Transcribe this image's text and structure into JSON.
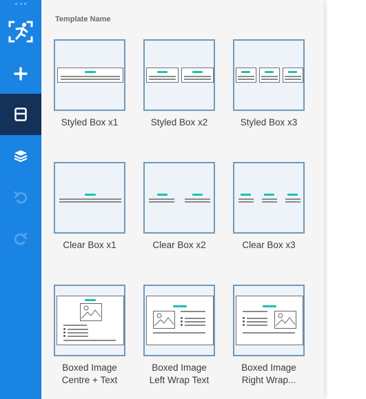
{
  "panel": {
    "title": "Template Name"
  },
  "sidebar": {
    "buttons": [
      {
        "name": "logo",
        "icon": "runner-logo-icon"
      },
      {
        "name": "add",
        "icon": "plus-icon"
      },
      {
        "name": "templates",
        "icon": "layout-icon",
        "active": true
      },
      {
        "name": "layers",
        "icon": "layers-icon"
      },
      {
        "name": "undo",
        "icon": "undo-icon",
        "disabled": true
      },
      {
        "name": "redo",
        "icon": "redo-icon",
        "disabled": true
      }
    ]
  },
  "templates": [
    {
      "label": "Styled Box x1"
    },
    {
      "label": "Styled Box x2"
    },
    {
      "label": "Styled Box x3"
    },
    {
      "label": "Clear Box x1"
    },
    {
      "label": "Clear Box x2"
    },
    {
      "label": "Clear Box x3"
    },
    {
      "label": "Boxed Image\nCentre + Text"
    },
    {
      "label": "Boxed Image\nLeft Wrap Text"
    },
    {
      "label": "Boxed Image\nRight Wrap..."
    }
  ],
  "colors": {
    "sidebar": "#1a84e4",
    "sidebar_active": "#14315a",
    "accent": "#1fbfb2",
    "thumb_border": "#6f98bc"
  }
}
